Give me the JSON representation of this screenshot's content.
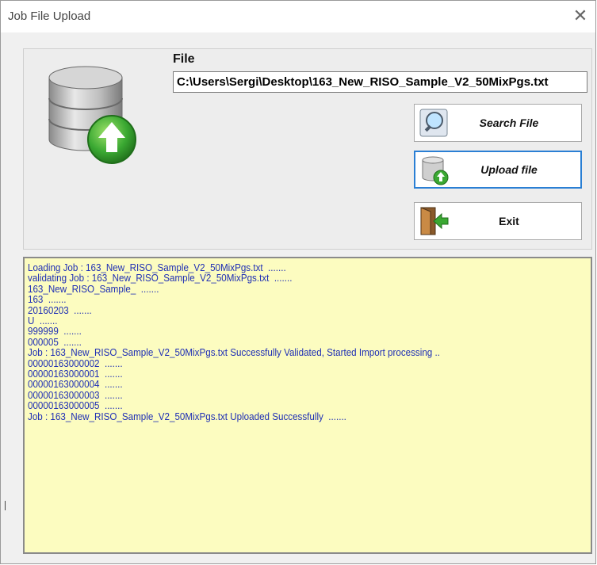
{
  "window": {
    "title": "Job File Upload",
    "close_icon": "close-icon"
  },
  "file": {
    "label": "File",
    "path": "C:\\Users\\Sergi\\Desktop\\163_New_RISO_Sample_V2_50MixPgs.txt"
  },
  "buttons": {
    "search": {
      "label": "Search File",
      "icon": "magnifier-icon"
    },
    "upload": {
      "label": "Upload file",
      "icon": "database-upload-icon"
    },
    "exit": {
      "label": "Exit",
      "icon": "exit-door-icon"
    }
  },
  "log": {
    "lines": [
      "Loading Job : 163_New_RISO_Sample_V2_50MixPgs.txt  .......",
      "validating Job : 163_New_RISO_Sample_V2_50MixPgs.txt  .......",
      "163_New_RISO_Sample_  .......",
      "163  .......",
      "20160203  .......",
      "U  .......",
      "999999  .......",
      "000005  .......",
      "Job : 163_New_RISO_Sample_V2_50MixPgs.txt Successfully Validated, Started Import processing ..",
      "00000163000002  .......",
      "00000163000001  .......",
      "00000163000004  .......",
      "00000163000003  .......",
      "00000163000005  .......",
      "Job : 163_New_RISO_Sample_V2_50MixPgs.txt Uploaded Successfully  ......."
    ]
  },
  "colors": {
    "log_background": "#fcfcc0",
    "log_text": "#1f2fb5",
    "focus_border": "#2a7fd4",
    "arrow_green": "#3aa832"
  }
}
